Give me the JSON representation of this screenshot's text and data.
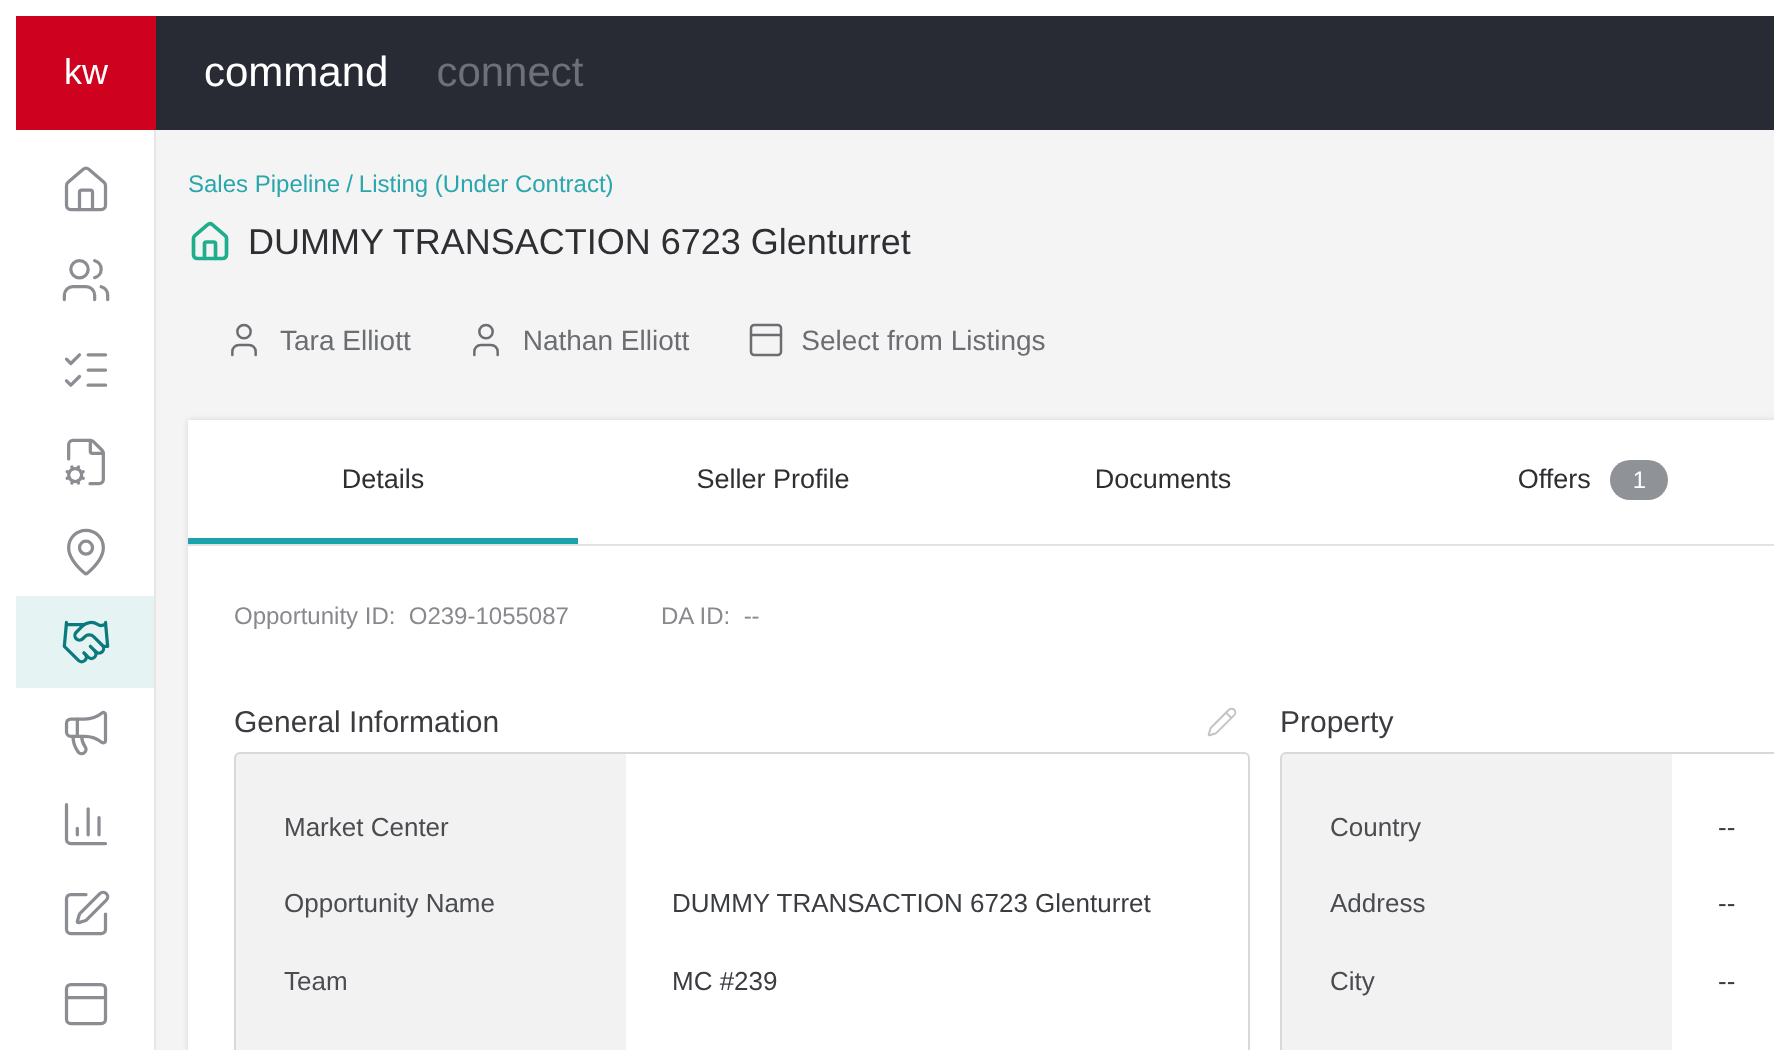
{
  "header": {
    "logo": "kw",
    "apps": [
      {
        "label": "command",
        "selected": true
      },
      {
        "label": "connect",
        "selected": false
      }
    ]
  },
  "sidebar": {
    "items": [
      {
        "kind": "home",
        "selected": false
      },
      {
        "kind": "people",
        "selected": false
      },
      {
        "kind": "tasks",
        "selected": false
      },
      {
        "kind": "settings-doc",
        "selected": false
      },
      {
        "kind": "pin",
        "selected": false
      },
      {
        "kind": "handshake",
        "selected": true
      },
      {
        "kind": "megaphone",
        "selected": false
      },
      {
        "kind": "chart",
        "selected": false
      },
      {
        "kind": "edit",
        "selected": false
      },
      {
        "kind": "board",
        "selected": false
      }
    ]
  },
  "breadcrumb": {
    "items": [
      "Sales Pipeline",
      "Listing (Under Contract)"
    ],
    "separator": "/"
  },
  "title": "DUMMY TRANSACTION 6723 Glenturret",
  "contacts": [
    {
      "kind": "person",
      "label": "Tara Elliott"
    },
    {
      "kind": "person",
      "label": "Nathan Elliott"
    },
    {
      "kind": "listing",
      "label": "Select from Listings"
    }
  ],
  "tabs": [
    {
      "label": "Details",
      "selected": true
    },
    {
      "label": "Seller Profile",
      "selected": false
    },
    {
      "label": "Documents",
      "selected": false
    },
    {
      "label": "Offers",
      "selected": false,
      "badge": "1"
    }
  ],
  "ids": [
    {
      "label": "Opportunity ID:",
      "value": "O239-1055087"
    },
    {
      "label": "DA ID:",
      "value": "--"
    }
  ],
  "general": {
    "title": "General Information",
    "rows": [
      {
        "label": "Market Center"
      },
      {
        "label": "Opportunity Name",
        "value": "DUMMY TRANSACTION 6723 Glenturret"
      },
      {
        "label": "Team",
        "value": "MC #239"
      }
    ]
  },
  "property": {
    "title": "Property",
    "rows": [
      {
        "label": "Country",
        "value": "--"
      },
      {
        "label": "Address",
        "value": "--"
      },
      {
        "label": "City",
        "value": "--"
      }
    ]
  }
}
